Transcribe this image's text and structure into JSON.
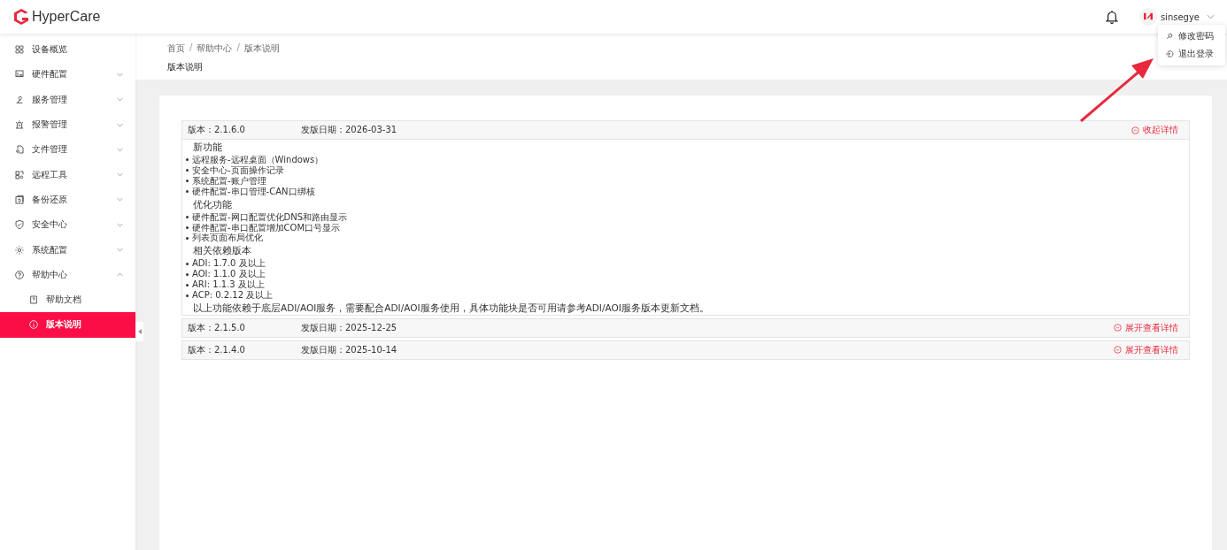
{
  "header": {
    "logo": "HyperCare",
    "user": {
      "name": "sinsegye"
    },
    "user_menu": [
      {
        "label": "修改密码"
      },
      {
        "label": "退出登录"
      }
    ]
  },
  "sidebar": {
    "items": [
      {
        "label": "设备概览"
      },
      {
        "label": "硬件配置",
        "expanded": false
      },
      {
        "label": "服务管理",
        "expanded": false
      },
      {
        "label": "报警管理",
        "expanded": false
      },
      {
        "label": "文件管理",
        "expanded": false
      },
      {
        "label": "远程工具",
        "expanded": false
      },
      {
        "label": "备份还原",
        "expanded": false
      },
      {
        "label": "安全中心",
        "expanded": false
      },
      {
        "label": "系统配置",
        "expanded": false
      },
      {
        "label": "帮助中心",
        "expanded": true,
        "children": [
          {
            "label": "帮助文档",
            "selected": false
          },
          {
            "label": "版本说明",
            "selected": true
          }
        ]
      }
    ]
  },
  "breadcrumb": {
    "separator": "/",
    "items": [
      "首页",
      "帮助中心",
      "版本说明"
    ]
  },
  "page_title": "版本说明",
  "versions": [
    {
      "version": "版本：2.1.6.0",
      "date": "发版日期：2026-03-31",
      "toggle": "收起详情",
      "expanded": true,
      "sections": [
        {
          "heading": "新功能",
          "items": [
            "远程服务-远程桌面（Windows）",
            "安全中心-页面操作记录",
            "系统配置-账户管理",
            "硬件配置-串口管理-CAN口绑核"
          ]
        },
        {
          "heading": "优化功能",
          "items": [
            "硬件配置-网口配置优化DNS和路由显示",
            "硬件配置-串口配置增加COM口号显示",
            "列表页面布局优化"
          ]
        },
        {
          "heading": "相关依赖版本",
          "items": [
            "ADI: 1.7.0 及以上",
            "AOI: 1.1.0 及以上",
            "ARI: 1.1.3 及以上",
            "ACP: 0.2.12 及以上"
          ]
        }
      ],
      "note": "以上功能依赖于底层ADI/AOI服务，需要配合ADI/AOI服务使用，具体功能块是否可用请参考ADI/AOI服务版本更新文档。"
    },
    {
      "version": "版本：2.1.5.0",
      "date": "发版日期：2025-12-25",
      "toggle": "展开查看详情",
      "expanded": false
    },
    {
      "version": "版本：2.1.4.0",
      "date": "发版日期：2025-10-14",
      "toggle": "展开查看详情",
      "expanded": false
    }
  ]
}
